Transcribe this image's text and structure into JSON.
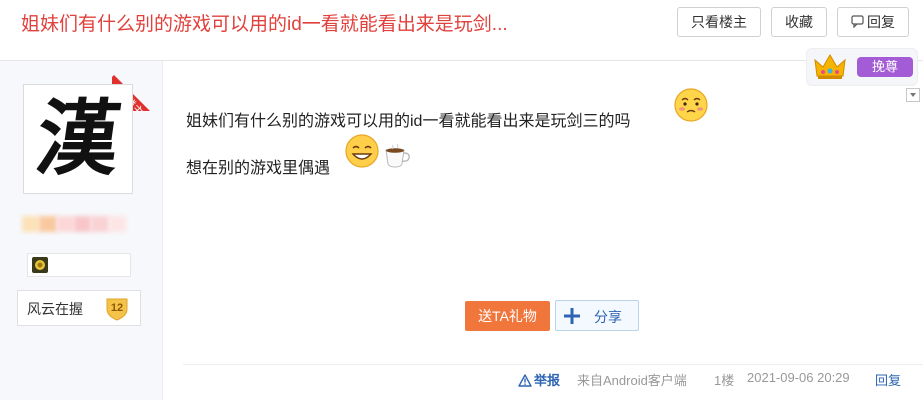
{
  "header": {
    "title": "姐妹们有什么别的游戏可以用的id一看就能看出来是玩剑...",
    "only_lz_label": "只看楼主",
    "favorite_label": "收藏",
    "reply_label": "回复"
  },
  "author": {
    "lz_tag": "楼主",
    "avatar_char": "漢",
    "level_name": "风云在握",
    "level_number": "12"
  },
  "post": {
    "line1": "姐妹们有什么别的游戏可以用的id一看就能看出来是玩剑三的吗",
    "line2": "想在别的游戏里偶遇",
    "gift_label": "送TA礼物",
    "share_label": "分享",
    "zun_label": "挽尊"
  },
  "footer": {
    "report_label": "举报",
    "source_label": "来自Android客户端",
    "floor_label": "1楼",
    "timestamp": "2021-09-06 20:29",
    "reply_label": "回复"
  },
  "icons": {
    "reply": "comment-icon",
    "crown": "crown-icon",
    "share": "plus-icon",
    "report": "warning-icon",
    "emoji1": "shy-face-emoji",
    "emoji2": "smile-face-emoji",
    "emoji3": "coffee-cup-emoji"
  },
  "colors": {
    "title_red": "#e1413c",
    "link_blue": "#2d64b3",
    "gift_orange": "#f1763c",
    "lz_red": "#e0312f",
    "zun_purple": "#a35bd6"
  }
}
